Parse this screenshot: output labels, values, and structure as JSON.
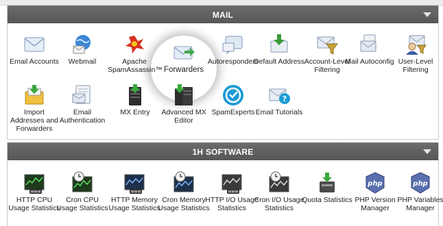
{
  "mail": {
    "title": "MAIL",
    "items": [
      {
        "label": "Email Accounts",
        "icon": "email-accounts-icon"
      },
      {
        "label": "Webmail",
        "icon": "webmail-icon"
      },
      {
        "label": "Apache SpamAssassin™",
        "icon": "spamassassin-icon",
        "logo_text": "SpamAssassin"
      },
      {
        "label": "Forwarders",
        "icon": "forwarders-icon"
      },
      {
        "label": "Autoresponders",
        "icon": "autoresponders-icon"
      },
      {
        "label": "Default Address",
        "icon": "default-address-icon"
      },
      {
        "label": "Account-Level Filtering",
        "icon": "account-filtering-icon"
      },
      {
        "label": "Mail Autoconfig",
        "icon": "mail-autoconfig-icon"
      },
      {
        "label": "User-Level Filtering",
        "icon": "user-filtering-icon"
      },
      {
        "label": "Import Addresses and Forwarders",
        "icon": "import-addresses-icon"
      },
      {
        "label": "Email Authentication",
        "icon": "email-authentication-icon"
      },
      {
        "label": "MX Entry",
        "icon": "mx-entry-icon"
      },
      {
        "label": "Advanced MX Editor",
        "icon": "advanced-mx-editor-icon"
      },
      {
        "label": "SpamExperts",
        "icon": "spamexperts-icon"
      },
      {
        "label": "Email Tutorials",
        "icon": "email-tutorials-icon"
      }
    ]
  },
  "software": {
    "title": "1H SOFTWARE",
    "items": [
      {
        "label": "HTTP CPU Usage Statistics",
        "icon": "http-cpu-icon",
        "badge": "www"
      },
      {
        "label": "Cron CPU Usage Statistics",
        "icon": "cron-cpu-icon"
      },
      {
        "label": "HTTP Memory Usage Statistics",
        "icon": "http-memory-icon",
        "badge": "www"
      },
      {
        "label": "Cron Memory Usage Statistics",
        "icon": "cron-memory-icon"
      },
      {
        "label": "HTTP I/O Usage Statistics",
        "icon": "http-io-icon",
        "badge": "www"
      },
      {
        "label": "Cron I/O Usage Statistics",
        "icon": "cron-io-icon"
      },
      {
        "label": "Quota Statistics",
        "icon": "quota-statistics-icon"
      },
      {
        "label": "PHP Version Manager",
        "icon": "php-version-icon",
        "badge": "php"
      },
      {
        "label": "PHP Variables Manager",
        "icon": "php-variables-icon",
        "badge": "php"
      }
    ]
  },
  "colors": {
    "header": "#5e5e5e",
    "accent_blue": "#1b9ad6",
    "accent_green": "#3aa83a"
  }
}
